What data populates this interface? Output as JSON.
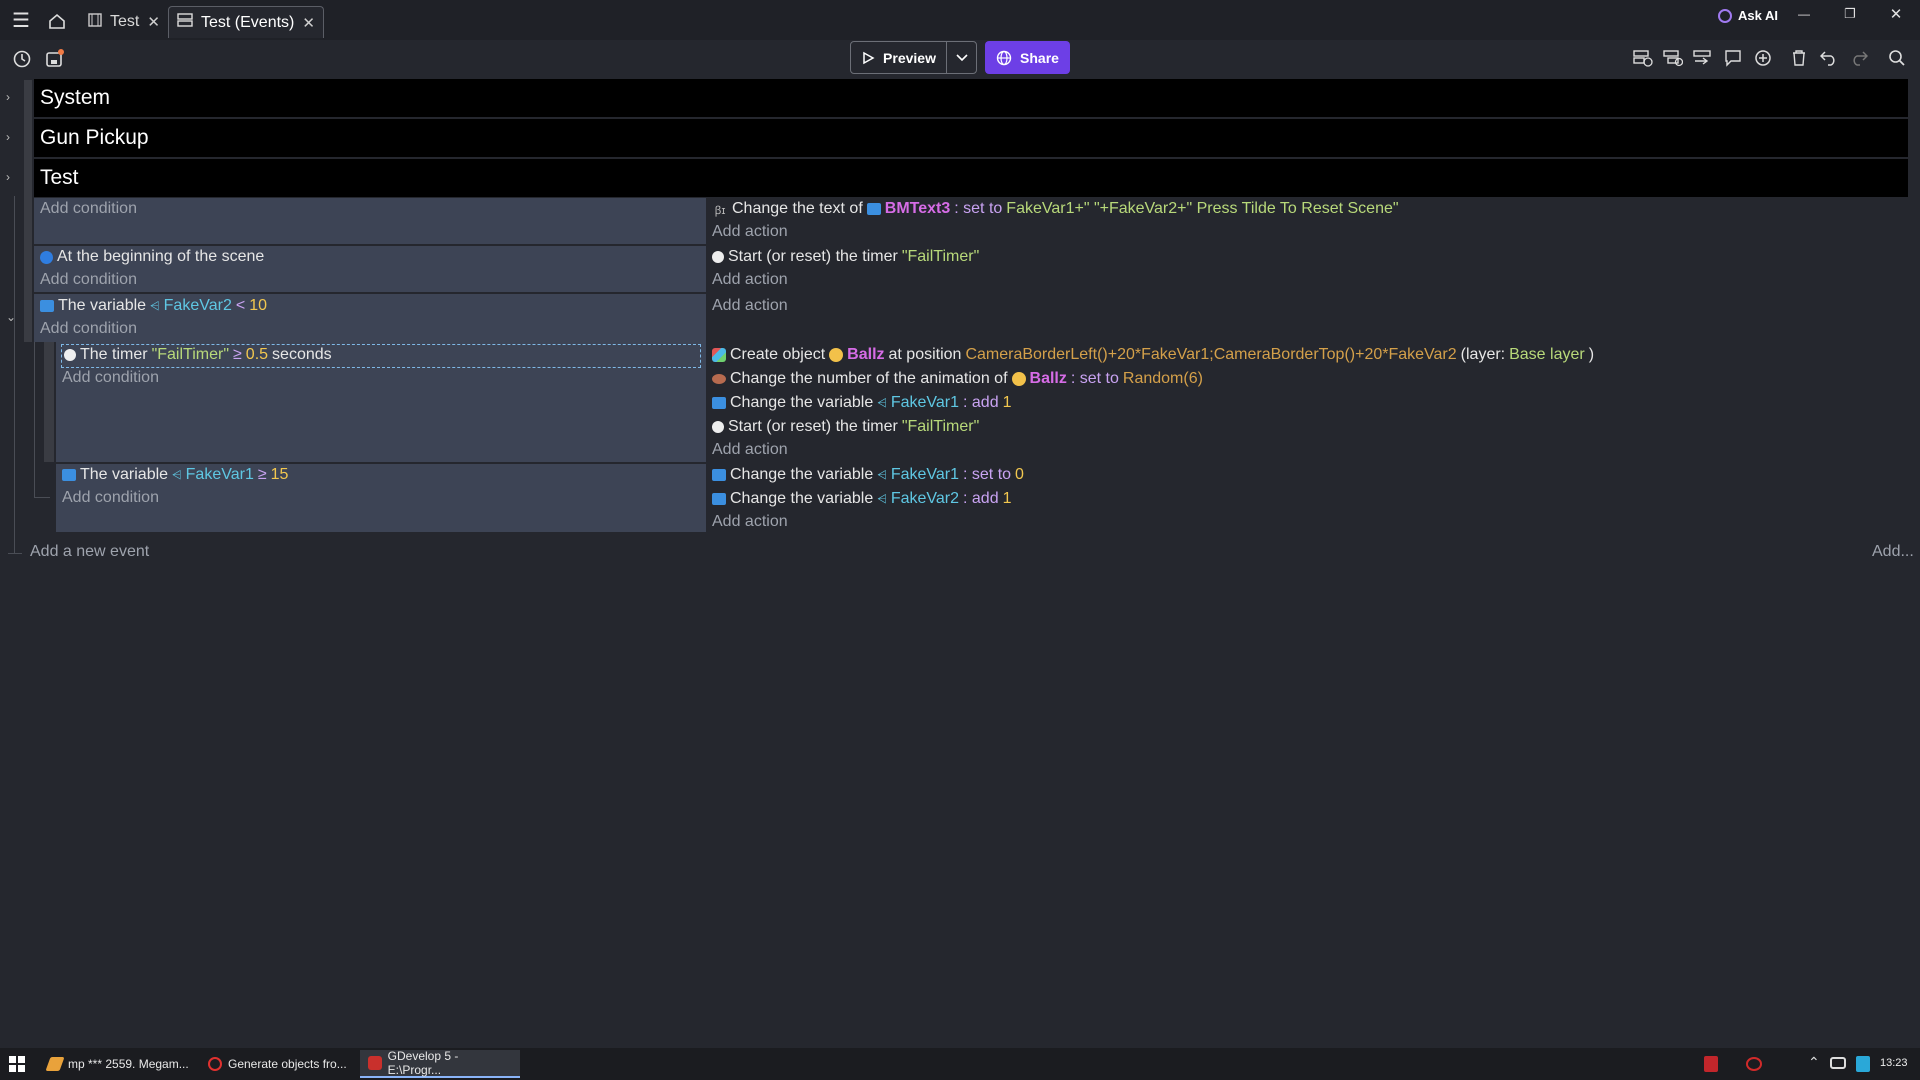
{
  "titlebar": {
    "tabs": [
      {
        "label": "Test",
        "close": "✕"
      },
      {
        "label": "Test (Events)",
        "close": "✕"
      }
    ],
    "ask_ai": "Ask AI",
    "window_controls": {
      "minimize": "—",
      "restore": "❐",
      "close": "✕"
    }
  },
  "toolbar": {
    "preview_label": "Preview",
    "share_label": "Share"
  },
  "groups": [
    {
      "label": "System"
    },
    {
      "label": "Gun Pickup"
    },
    {
      "label": "Test"
    }
  ],
  "events": {
    "e1": {
      "add_condition": "Add condition",
      "action1": {
        "prefix": "Change the text of",
        "object": "BMText3",
        "op": ": set to",
        "value": "FakeVar1+\" \"+FakeVar2+\" Press Tilde To Reset Scene\""
      },
      "add_action": "Add action"
    },
    "e2": {
      "condition": "At the beginning of the scene",
      "add_condition": "Add condition",
      "action_prefix": "Start (or reset) the timer",
      "action_value": "\"FailTimer\"",
      "add_action": "Add action"
    },
    "e3": {
      "cond_prefix": "The variable",
      "cond_var": "FakeVar2",
      "cond_op": "<",
      "cond_value": "10",
      "add_condition": "Add condition",
      "add_action": "Add action"
    },
    "e4": {
      "cond_prefix": "The timer",
      "cond_timer": "\"FailTimer\"",
      "cond_op": "≥",
      "cond_value": "0.5",
      "cond_suffix": "seconds",
      "add_condition": "Add condition",
      "a1_prefix": "Create object",
      "a1_object": "Ballz",
      "a1_mid": "at position",
      "a1_pos": "CameraBorderLeft()+20*FakeVar1;CameraBorderTop()+20*FakeVar2",
      "a1_layer_open": "(layer:",
      "a1_layer": "Base layer",
      "a1_layer_close": ")",
      "a2_prefix": "Change the number of the animation of",
      "a2_object": "Ballz",
      "a2_op": ": set to",
      "a2_value": "Random(6)",
      "a3_prefix": "Change the variable",
      "a3_var": "FakeVar1",
      "a3_op": ": add",
      "a3_value": "1",
      "a4_prefix": "Start (or reset) the timer",
      "a4_value": "\"FailTimer\"",
      "add_action": "Add action"
    },
    "e5": {
      "cond_prefix": "The variable",
      "cond_var": "FakeVar1",
      "cond_op": "≥",
      "cond_value": "15",
      "add_condition": "Add condition",
      "a1_prefix": "Change the variable",
      "a1_var": "FakeVar1",
      "a1_op": ": set to",
      "a1_value": "0",
      "a2_prefix": "Change the variable",
      "a2_var": "FakeVar2",
      "a2_op": ": add",
      "a2_value": "1",
      "add_action": "Add action"
    }
  },
  "footer": {
    "add_event": "Add a new event",
    "add_more": "Add..."
  },
  "taskbar": {
    "items": [
      {
        "label": "mp *** 2559. Megam..."
      },
      {
        "label": "Generate objects fro..."
      },
      {
        "label": "GDevelop 5 - E:\\Progr..."
      }
    ],
    "clock": "13:23"
  },
  "colors": {
    "accent": "#6d3fe6",
    "condition_bg": "#3d4455",
    "background": "#25272e"
  }
}
